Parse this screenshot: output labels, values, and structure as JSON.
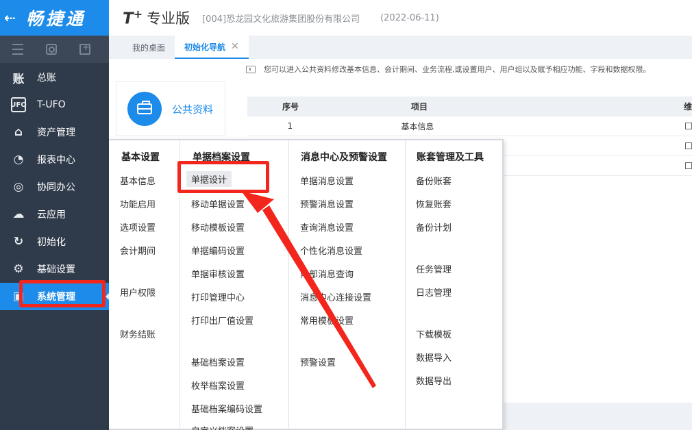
{
  "brand": {
    "back_icon": "arrow-left-icon",
    "name": "畅捷通"
  },
  "header": {
    "logo": "T",
    "logo_plus": "+",
    "edition": "专业版",
    "company": "[004]恐龙园文化旅游集团股份有限公司",
    "date": "(2022-06-11)"
  },
  "tabs": [
    {
      "label": "我的桌面"
    },
    {
      "label": "初始化导航",
      "close": "✕"
    }
  ],
  "sidebar": {
    "tools": [
      "menu-icon",
      "search-icon",
      "add-icon"
    ],
    "items": [
      {
        "label": "总账",
        "icon": "ledger-icon",
        "glyph": "账"
      },
      {
        "label": "T-UFO",
        "icon": "ufo-icon",
        "glyph": "UFO"
      },
      {
        "label": "资产管理",
        "icon": "bank-icon",
        "glyph": "⌂"
      },
      {
        "label": "报表中心",
        "icon": "pie-chart-icon",
        "glyph": "◔"
      },
      {
        "label": "协同办公",
        "icon": "collab-icon",
        "glyph": "◎"
      },
      {
        "label": "云应用",
        "icon": "cloud-icon",
        "glyph": "☁"
      },
      {
        "label": "初始化",
        "icon": "refresh-icon",
        "glyph": "↻"
      },
      {
        "label": "基础设置",
        "icon": "settings-icon",
        "glyph": "⚙"
      },
      {
        "label": "系统管理",
        "icon": "system-icon",
        "glyph": "▣"
      }
    ]
  },
  "hint": "您可以进入公共资料修改基本信息、会计期间、业务流程,或设置用户、用户组以及赋予相应功能、字段和数据权限。",
  "public_card": {
    "label": "公共资料"
  },
  "table": {
    "headers": [
      "序号",
      "项目",
      "维"
    ],
    "rows": [
      {
        "no": "1",
        "item": "基本信息"
      },
      {
        "no": "",
        "item": ""
      },
      {
        "no": "",
        "item": ""
      }
    ]
  },
  "menu": {
    "col1": {
      "title": "基本设置",
      "items": [
        "基本信息",
        "功能启用",
        "选项设置",
        "会计期间",
        "用户权限",
        "财务结账"
      ]
    },
    "col2": {
      "title": "单据档案设置",
      "items": [
        "单据设计",
        "移动单据设置",
        "移动模板设置",
        "单据编码设置",
        "单据审核设置",
        "打印管理中心",
        "打印出厂值设置",
        "基础档案设置",
        "枚举档案设置",
        "基础档案编码设置",
        "自定义档案设置"
      ]
    },
    "col3": {
      "title": "消息中心及预警设置",
      "items": [
        "单据消息设置",
        "预警消息设置",
        "查询消息设置",
        "个性化消息设置",
        "内部消息查询",
        "消息中心连接设置",
        "常用模板设置",
        "预警设置"
      ]
    },
    "col4": {
      "title": "账套管理及工具",
      "items": [
        "备份账套",
        "恢复账套",
        "备份计划",
        "任务管理",
        "日志管理",
        "下载模板",
        "数据导入",
        "数据导出"
      ]
    }
  },
  "colors": {
    "brand_blue": "#1d8bea",
    "sidebar_bg": "#2f3a4a",
    "annotation_red": "#f2261c"
  }
}
